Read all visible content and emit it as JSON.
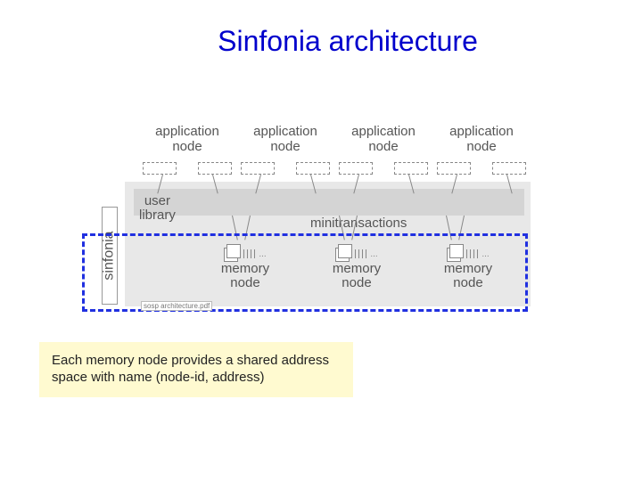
{
  "title": "Sinfonia architecture",
  "sinfonia_label": "sinfonia",
  "app_node_label_line1": "application",
  "app_node_label_line2": "node",
  "user_library_line1": "user",
  "user_library_line2": "library",
  "minitransactions": "minitransactions",
  "memory_node_line1": "memory",
  "memory_node_line2": "node",
  "ticks_ellipsis": "...",
  "pdf_badge": "sosp architecture.pdf",
  "note_text": "Each memory node provides a shared address space with name (node-id, address)"
}
